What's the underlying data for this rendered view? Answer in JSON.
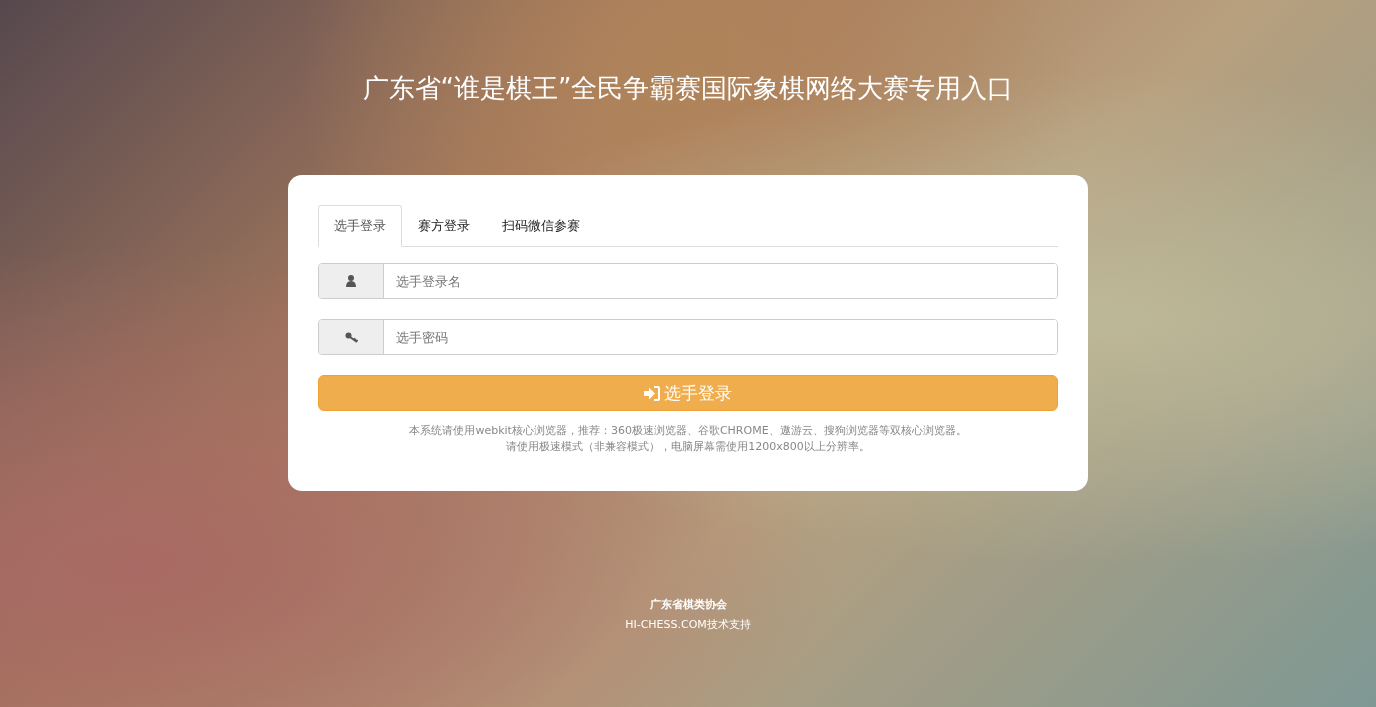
{
  "title": "广东省“谁是棋王”全民争霸赛国际象棋网络大赛专用入口",
  "tabs": [
    {
      "label": "选手登录",
      "selected": true
    },
    {
      "label": "赛方登录",
      "selected": false
    },
    {
      "label": "扫码微信参赛",
      "selected": false
    }
  ],
  "fields": [
    {
      "kind": "user",
      "placeholder": "选手登录名"
    },
    {
      "kind": "key",
      "placeholder": "选手密码"
    }
  ],
  "login_button": "选手登录",
  "notes": [
    "本系统请使用webkit核心浏览器，推荐：360极速浏览器、谷歌CHROME、遨游云、搜狗浏览器等双核心浏览器。",
    "请使用极速模式（非兼容模式），电脑屏幕需使用1200x800以上分辨率。"
  ],
  "footer": [
    "广东省棋类协会",
    "HI-CHESS.COM技术支持"
  ]
}
